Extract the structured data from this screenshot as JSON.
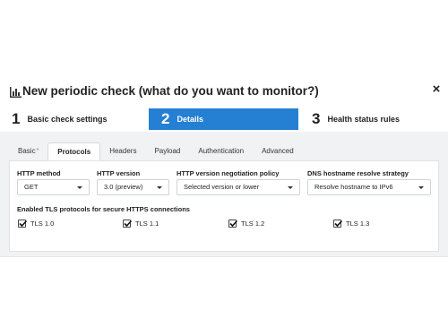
{
  "modal": {
    "title": "New periodic check (what do you want to monitor?)",
    "close_symbol": "×"
  },
  "steps": [
    {
      "number": "1",
      "label": "Basic check settings",
      "active": false
    },
    {
      "number": "2",
      "label": "Details",
      "active": true
    },
    {
      "number": "3",
      "label": "Health status rules",
      "active": false
    }
  ],
  "tabs": [
    {
      "label": "Basic",
      "required_mark": "*",
      "active": false
    },
    {
      "label": "Protocols",
      "active": true
    },
    {
      "label": "Headers",
      "active": false
    },
    {
      "label": "Payload",
      "active": false
    },
    {
      "label": "Authentication",
      "active": false
    },
    {
      "label": "Advanced",
      "active": false
    }
  ],
  "fields": {
    "http_method": {
      "label": "HTTP method",
      "value": "GET"
    },
    "http_version": {
      "label": "HTTP version",
      "value": "3.0 (preview)"
    },
    "negotiation_policy": {
      "label": "HTTP version negotiation policy",
      "value": "Selected version or lower"
    },
    "dns_strategy": {
      "label": "DNS hostname resolve strategy",
      "value": "Resolve hostname to IPv6"
    }
  },
  "tls": {
    "label": "Enabled TLS protocols for secure HTTPS connections",
    "options": [
      {
        "label": "TLS 1.0",
        "checked": true
      },
      {
        "label": "TLS 1.1",
        "checked": true
      },
      {
        "label": "TLS 1.2",
        "checked": true
      },
      {
        "label": "TLS 1.3",
        "checked": true
      }
    ]
  },
  "colors": {
    "accent": "#2580d4",
    "panel_bg": "#f1f2f4"
  },
  "icons": {
    "title": "bar-chart-icon",
    "close": "close-icon",
    "dropdown": "chevron-down-icon",
    "checkbox": "checkmark-icon"
  }
}
